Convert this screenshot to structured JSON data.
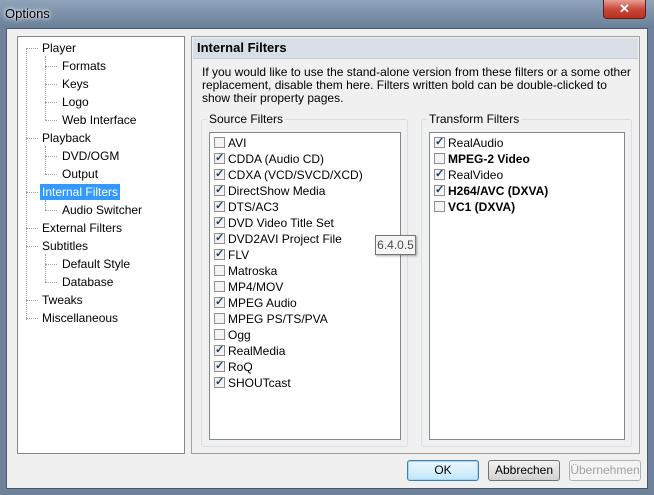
{
  "window": {
    "title": "Options",
    "close_label": "✕"
  },
  "tree": {
    "items": [
      {
        "label": "Player"
      },
      {
        "label": "Formats"
      },
      {
        "label": "Keys"
      },
      {
        "label": "Logo"
      },
      {
        "label": "Web Interface"
      },
      {
        "label": "Playback"
      },
      {
        "label": "DVD/OGM"
      },
      {
        "label": "Output"
      },
      {
        "label": "Internal Filters"
      },
      {
        "label": "Audio Switcher"
      },
      {
        "label": "External Filters"
      },
      {
        "label": "Subtitles"
      },
      {
        "label": "Default Style"
      },
      {
        "label": "Database"
      },
      {
        "label": "Tweaks"
      },
      {
        "label": "Miscellaneous"
      }
    ]
  },
  "panel": {
    "title": "Internal Filters",
    "description": "If you would like to use the stand-alone version from these filters or a some other replacement, disable them here. Filters written bold can be double-clicked to show their property pages."
  },
  "source_filters": {
    "label": "Source Filters",
    "items": [
      {
        "label": "AVI",
        "checked": false
      },
      {
        "label": "CDDA (Audio CD)",
        "checked": true
      },
      {
        "label": "CDXA (VCD/SVCD/XCD)",
        "checked": true
      },
      {
        "label": "DirectShow Media",
        "checked": true
      },
      {
        "label": "DTS/AC3",
        "checked": true
      },
      {
        "label": "DVD Video Title Set",
        "checked": true
      },
      {
        "label": "DVD2AVI Project File",
        "checked": true
      },
      {
        "label": "FLV",
        "checked": true
      },
      {
        "label": "Matroska",
        "checked": false
      },
      {
        "label": "MP4/MOV",
        "checked": false
      },
      {
        "label": "MPEG Audio",
        "checked": true
      },
      {
        "label": "MPEG PS/TS/PVA",
        "checked": false
      },
      {
        "label": "Ogg",
        "checked": false
      },
      {
        "label": "RealMedia",
        "checked": true
      },
      {
        "label": "RoQ",
        "checked": true
      },
      {
        "label": "SHOUTcast",
        "checked": true
      }
    ]
  },
  "transform_filters": {
    "label": "Transform Filters",
    "items": [
      {
        "label": "RealAudio",
        "checked": true,
        "bold": false
      },
      {
        "label": "MPEG-2 Video",
        "checked": false,
        "bold": true
      },
      {
        "label": "RealVideo",
        "checked": true,
        "bold": false
      },
      {
        "label": "H264/AVC (DXVA)",
        "checked": true,
        "bold": true
      },
      {
        "label": "VC1 (DXVA)",
        "checked": false,
        "bold": true
      }
    ]
  },
  "tooltip": {
    "text": "6.4.0.5"
  },
  "buttons": {
    "ok": "OK",
    "cancel": "Abbrechen",
    "apply": "Übernehmen"
  }
}
